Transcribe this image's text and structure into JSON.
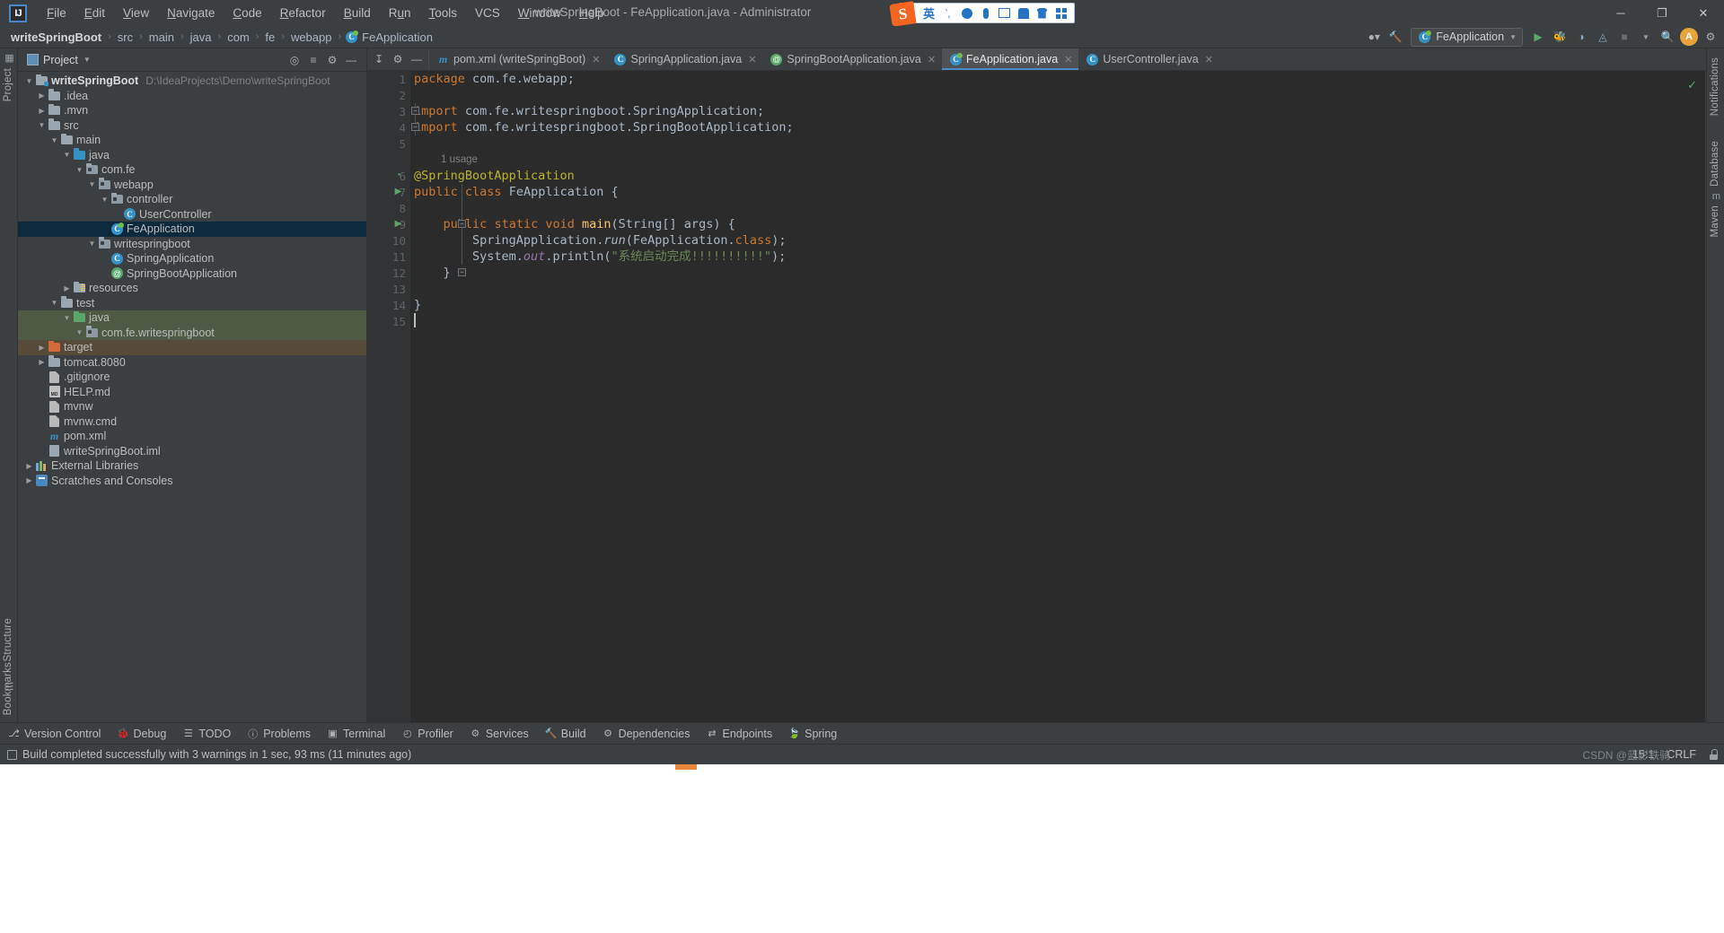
{
  "titlebar": {
    "logo_text": "IJ",
    "window_title": "writeSpringBoot - FeApplication.java - Administrator",
    "menus": [
      {
        "label": "File",
        "mnemonic": "F"
      },
      {
        "label": "Edit",
        "mnemonic": "E"
      },
      {
        "label": "View",
        "mnemonic": "V"
      },
      {
        "label": "Navigate",
        "mnemonic": "N"
      },
      {
        "label": "Code",
        "mnemonic": "C"
      },
      {
        "label": "Refactor",
        "mnemonic": "R"
      },
      {
        "label": "Build",
        "mnemonic": "B"
      },
      {
        "label": "Run",
        "mnemonic": "u"
      },
      {
        "label": "Tools",
        "mnemonic": "T"
      },
      {
        "label": "VCS",
        "mnemonic": ""
      },
      {
        "label": "Window",
        "mnemonic": "W"
      },
      {
        "label": "Help",
        "mnemonic": "H"
      }
    ],
    "window_controls": [
      {
        "name": "minimize",
        "glyph": "─"
      },
      {
        "name": "maximize",
        "glyph": "❐"
      },
      {
        "name": "close",
        "glyph": "✕"
      }
    ]
  },
  "ime": {
    "logo": "S",
    "buttons": [
      {
        "name": "ime-mode-chinese",
        "label": "英"
      },
      {
        "name": "ime-punctuation",
        "label": "‵,"
      },
      {
        "name": "ime-emoji",
        "label": ""
      },
      {
        "name": "ime-voice-input",
        "label": ""
      },
      {
        "name": "ime-soft-keyboard",
        "label": ""
      },
      {
        "name": "ime-user-center",
        "label": ""
      },
      {
        "name": "ime-skin",
        "label": ""
      },
      {
        "name": "ime-toolbox",
        "label": ""
      }
    ]
  },
  "breadcrumb": {
    "items": [
      "writeSpringBoot",
      "src",
      "main",
      "java",
      "com",
      "fe",
      "webapp",
      "FeApplication"
    ],
    "separator": "›"
  },
  "navbar_right": {
    "run_config": "FeApplication",
    "buttons": [
      {
        "name": "user-settings",
        "glyph": "⛏"
      },
      {
        "name": "build-hammer",
        "glyph": "🔨"
      },
      {
        "name": "run-button",
        "glyph": "▶"
      },
      {
        "name": "debug-button",
        "glyph": "🐞"
      },
      {
        "name": "run-with-coverage",
        "glyph": "◐"
      },
      {
        "name": "profiler-button",
        "glyph": "◴"
      },
      {
        "name": "stop-button",
        "glyph": "■"
      },
      {
        "name": "search-everywhere",
        "glyph": "🔍"
      },
      {
        "name": "account-avatar",
        "glyph": "A"
      },
      {
        "name": "settings-gear",
        "glyph": "⚙"
      }
    ]
  },
  "project_panel": {
    "title": "Project",
    "header_buttons": [
      {
        "name": "select-opened-file",
        "glyph": "◎"
      },
      {
        "name": "expand-all",
        "glyph": "≣"
      },
      {
        "name": "collapse-all",
        "glyph": "≡"
      },
      {
        "name": "panel-settings",
        "glyph": "⚙"
      },
      {
        "name": "hide-panel",
        "glyph": "─"
      }
    ],
    "tree": [
      {
        "label": "writeSpringBoot",
        "path_hint": "D:\\IdeaProjects\\Demo\\writeSpringBoot",
        "indent": 0,
        "arrow": "down",
        "icon": "module-folder",
        "bold": true,
        "state": "normal"
      },
      {
        "label": ".idea",
        "indent": 1,
        "arrow": "right",
        "icon": "folder",
        "state": "normal"
      },
      {
        "label": ".mvn",
        "indent": 1,
        "arrow": "right",
        "icon": "folder",
        "state": "normal"
      },
      {
        "label": "src",
        "indent": 1,
        "arrow": "down",
        "icon": "folder",
        "state": "normal"
      },
      {
        "label": "main",
        "indent": 2,
        "arrow": "down",
        "icon": "folder",
        "state": "normal"
      },
      {
        "label": "java",
        "indent": 3,
        "arrow": "down",
        "icon": "folder-blue",
        "state": "normal"
      },
      {
        "label": "com.fe",
        "indent": 4,
        "arrow": "down",
        "icon": "package",
        "state": "normal"
      },
      {
        "label": "webapp",
        "indent": 5,
        "arrow": "down",
        "icon": "package",
        "state": "normal"
      },
      {
        "label": "controller",
        "indent": 6,
        "arrow": "down",
        "icon": "package",
        "state": "normal"
      },
      {
        "label": "UserController",
        "indent": 7,
        "arrow": "none",
        "icon": "class",
        "state": "normal"
      },
      {
        "label": "FeApplication",
        "indent": 6,
        "arrow": "none",
        "icon": "spring-class",
        "state": "selected"
      },
      {
        "label": "writespringboot",
        "indent": 5,
        "arrow": "down",
        "icon": "package",
        "state": "normal"
      },
      {
        "label": "SpringApplication",
        "indent": 6,
        "arrow": "none",
        "icon": "class",
        "state": "normal"
      },
      {
        "label": "SpringBootApplication",
        "indent": 6,
        "arrow": "none",
        "icon": "annotation",
        "state": "normal"
      },
      {
        "label": "resources",
        "indent": 3,
        "arrow": "right",
        "icon": "folder-resources",
        "state": "normal"
      },
      {
        "label": "test",
        "indent": 2,
        "arrow": "down",
        "icon": "folder",
        "state": "normal"
      },
      {
        "label": "java",
        "indent": 3,
        "arrow": "down",
        "icon": "folder-green",
        "state": "test-scope"
      },
      {
        "label": "com.fe.writespringboot",
        "indent": 4,
        "arrow": "down",
        "icon": "package",
        "state": "test-scope"
      },
      {
        "label": "target",
        "indent": 1,
        "arrow": "right",
        "icon": "folder-orange",
        "state": "excluded"
      },
      {
        "label": "tomcat.8080",
        "indent": 1,
        "arrow": "right",
        "icon": "folder",
        "state": "normal"
      },
      {
        "label": ".gitignore",
        "indent": 1,
        "arrow": "none",
        "icon": "file-gitignore",
        "state": "normal"
      },
      {
        "label": "HELP.md",
        "indent": 1,
        "arrow": "none",
        "icon": "file-markdown",
        "state": "normal"
      },
      {
        "label": "mvnw",
        "indent": 1,
        "arrow": "none",
        "icon": "file-plain",
        "state": "normal"
      },
      {
        "label": "mvnw.cmd",
        "indent": 1,
        "arrow": "none",
        "icon": "file-plain",
        "state": "normal"
      },
      {
        "label": "pom.xml",
        "indent": 1,
        "arrow": "none",
        "icon": "file-maven",
        "state": "normal"
      },
      {
        "label": "writeSpringBoot.iml",
        "indent": 1,
        "arrow": "none",
        "icon": "file-iml",
        "state": "normal"
      },
      {
        "label": "External Libraries",
        "indent": 0,
        "arrow": "right",
        "icon": "libraries",
        "state": "normal"
      },
      {
        "label": "Scratches and Consoles",
        "indent": 0,
        "arrow": "right",
        "icon": "scratches",
        "state": "normal"
      }
    ]
  },
  "left_strip": [
    {
      "label": "Project",
      "name": "tool-project"
    },
    {
      "label": "Structure",
      "name": "tool-structure"
    },
    {
      "label": "Bookmarks",
      "name": "tool-bookmarks"
    }
  ],
  "right_strip": [
    {
      "label": "Notifications",
      "name": "tool-notifications"
    },
    {
      "label": "Database",
      "name": "tool-database"
    },
    {
      "label": "Maven",
      "name": "tool-maven"
    }
  ],
  "editor": {
    "toolbar_buttons": [
      {
        "name": "sort-alphabetically",
        "glyph": "↧"
      },
      {
        "name": "settings-gear",
        "glyph": "⚙"
      },
      {
        "name": "hide-tabs",
        "glyph": "─"
      }
    ],
    "tabs": [
      {
        "label": "pom.xml (writeSpringBoot)",
        "icon": "maven",
        "active": false,
        "closable": true
      },
      {
        "label": "SpringApplication.java",
        "icon": "class",
        "active": false,
        "closable": true
      },
      {
        "label": "SpringBootApplication.java",
        "icon": "annotation",
        "active": false,
        "closable": true
      },
      {
        "label": "FeApplication.java",
        "icon": "spring-class",
        "active": true,
        "closable": true
      },
      {
        "label": "UserController.java",
        "icon": "class",
        "active": false,
        "closable": true
      }
    ],
    "inspection_status": "✓",
    "usage_hint": "1 usage",
    "line_numbers": [
      1,
      2,
      3,
      4,
      5,
      6,
      7,
      8,
      9,
      10,
      11,
      12,
      13,
      14,
      15
    ],
    "code": [
      {
        "line": 1,
        "text": "package com.fe.webapp;"
      },
      {
        "line": 2,
        "text": ""
      },
      {
        "line": 3,
        "text": "import com.fe.writespringboot.SpringApplication;"
      },
      {
        "line": 4,
        "text": "import com.fe.writespringboot.SpringBootApplication;"
      },
      {
        "line": 5,
        "text": ""
      },
      {
        "line": 6,
        "text": "@SpringBootApplication"
      },
      {
        "line": 7,
        "text": "public class FeApplication {"
      },
      {
        "line": 8,
        "text": ""
      },
      {
        "line": 9,
        "text": "    public static void main(String[] args) {"
      },
      {
        "line": 10,
        "text": "        SpringApplication.run(FeApplication.class);"
      },
      {
        "line": 11,
        "text": "        System.out.println(\"系统启动完成!!!!!!!!!!\");"
      },
      {
        "line": 12,
        "text": "    }"
      },
      {
        "line": 13,
        "text": ""
      },
      {
        "line": 14,
        "text": "}"
      },
      {
        "line": 15,
        "text": ""
      }
    ],
    "gutter_markers": [
      {
        "line": 6,
        "type": "spring-bean",
        "glyph": "◔"
      },
      {
        "line": 7,
        "type": "run-class",
        "glyph": "▶"
      },
      {
        "line": 9,
        "type": "run-method",
        "glyph": "▶"
      }
    ]
  },
  "bottom_bar": [
    {
      "label": "Version Control",
      "icon": "branch-icon"
    },
    {
      "label": "Debug",
      "icon": "debug-icon"
    },
    {
      "label": "TODO",
      "icon": "todo-icon"
    },
    {
      "label": "Problems",
      "icon": "problems-icon"
    },
    {
      "label": "Terminal",
      "icon": "terminal-icon"
    },
    {
      "label": "Profiler",
      "icon": "profiler-icon"
    },
    {
      "label": "Services",
      "icon": "services-icon"
    },
    {
      "label": "Build",
      "icon": "build-icon"
    },
    {
      "label": "Dependencies",
      "icon": "dependencies-icon"
    },
    {
      "label": "Endpoints",
      "icon": "endpoints-icon"
    },
    {
      "label": "Spring",
      "icon": "spring-icon"
    }
  ],
  "statusbar": {
    "message": "Build completed successfully with 3 warnings in 1 sec, 93 ms (11 minutes ago)",
    "caret_position": "15:1",
    "line_separator": "CRLF",
    "watermark": "CSDN @蓝影铁骑"
  },
  "colors": {
    "accent_blue": "#4a88c7",
    "selection_blue": "#0d293e",
    "keyword_orange": "#cc7832",
    "annotation_yellow": "#bbb529",
    "string_green": "#6a8759",
    "field_purple": "#9876aa",
    "run_green": "#59a869",
    "panel_bg": "#3c3f41",
    "editor_bg": "#2b2b2b",
    "gutter_bg": "#313335"
  }
}
